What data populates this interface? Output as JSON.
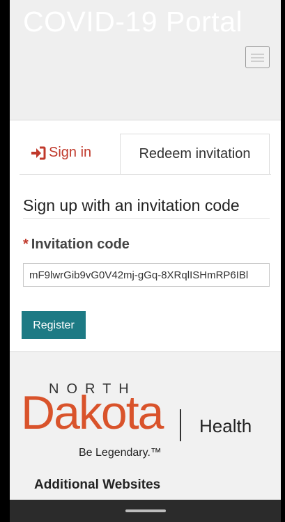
{
  "header": {
    "title": "COVID-19 Portal"
  },
  "tabs": {
    "sign_in": "Sign in",
    "redeem": "Redeem invitation"
  },
  "form": {
    "heading": "Sign up with an invitation code",
    "required_marker": "*",
    "label": "Invitation code",
    "code_value": "mF9lwrGib9vG0V42mj-gGq-8XRqlISHmRP6IBl",
    "register_label": "Register"
  },
  "footer": {
    "logo_north": "NORTH",
    "logo_dakota": "Dakota",
    "logo_health": "Health",
    "logo_tagline": "Be Legendary.™",
    "additional_websites": "Additional Websites"
  },
  "colors": {
    "brand_orange": "#d9532b",
    "register_teal": "#1d7a84",
    "signin_red": "#c0392b"
  },
  "icons": {
    "sign_in": "sign-in-icon",
    "menu": "hamburger-menu-icon"
  }
}
